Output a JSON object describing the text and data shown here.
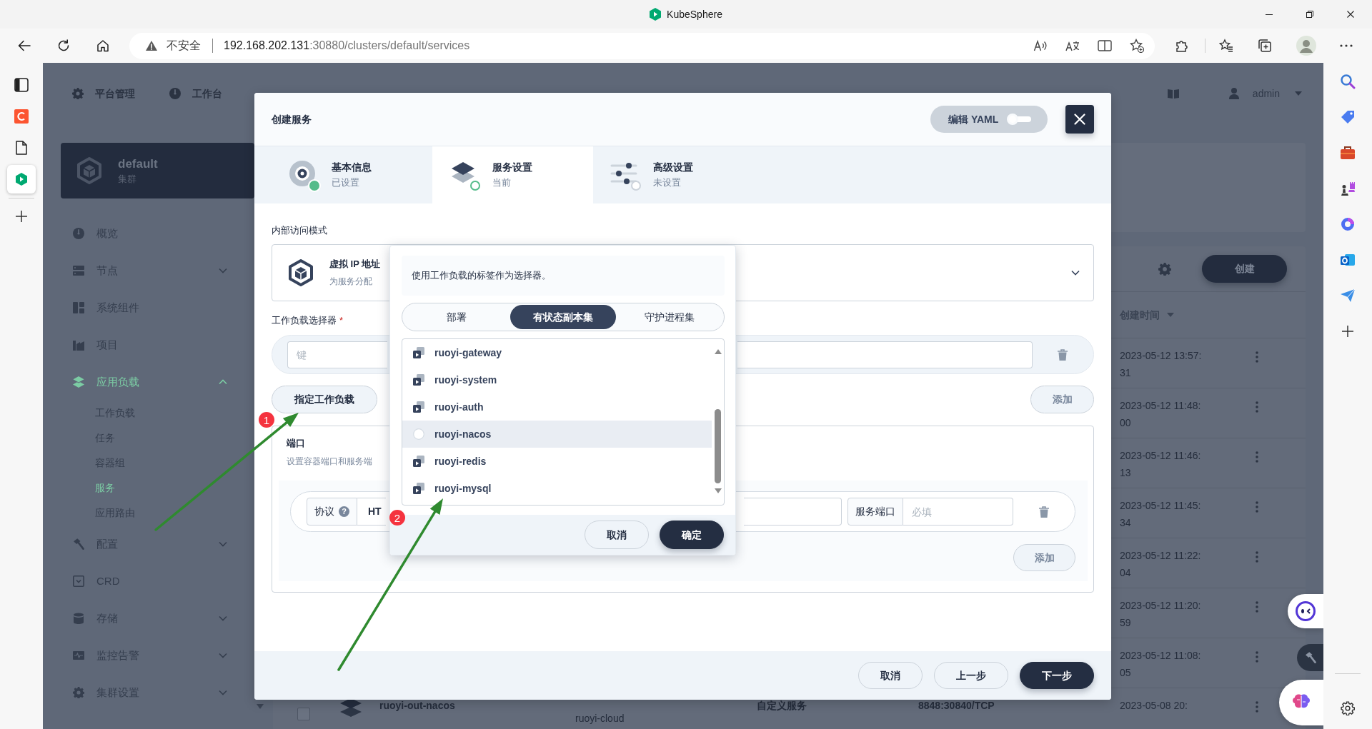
{
  "browser": {
    "title": "KubeSphere",
    "security_label": "不安全",
    "url_host": "192.168.202.131",
    "url_path": ":30880/clusters/default/services",
    "side_tabs": [
      {
        "selected": false
      },
      {
        "selected": false
      },
      {
        "selected": false
      },
      {
        "selected": true
      }
    ]
  },
  "console": {
    "top_nav": [
      "平台管理",
      "工作台"
    ],
    "user": "admin",
    "cluster": {
      "name": "default",
      "type": "集群"
    },
    "nav": [
      {
        "label": "概览",
        "kind": "link",
        "selected": false
      },
      {
        "label": "节点",
        "kind": "group",
        "expanded": false,
        "selected": false
      },
      {
        "label": "系统组件",
        "kind": "link",
        "selected": false
      },
      {
        "label": "项目",
        "kind": "link",
        "selected": false
      },
      {
        "label": "应用负载",
        "kind": "group",
        "expanded": true,
        "selected": true,
        "children": [
          {
            "label": "工作负载",
            "selected": false
          },
          {
            "label": "任务",
            "selected": false
          },
          {
            "label": "容器组",
            "selected": false
          },
          {
            "label": "服务",
            "selected": true
          },
          {
            "label": "应用路由",
            "selected": false
          }
        ]
      },
      {
        "label": "配置",
        "kind": "group",
        "expanded": false,
        "selected": false
      },
      {
        "label": "CRD",
        "kind": "link",
        "selected": false
      },
      {
        "label": "存储",
        "kind": "group",
        "expanded": false,
        "selected": false
      },
      {
        "label": "监控告警",
        "kind": "group",
        "expanded": false,
        "selected": false
      },
      {
        "label": "集群设置",
        "kind": "group",
        "expanded": false,
        "selected": false
      }
    ],
    "create_button": "创建",
    "table": {
      "columns": [
        {
          "label": "创建时间"
        }
      ],
      "rows": [
        {
          "created": "2023-05-12 13:57:31"
        },
        {
          "created": "2023-05-12 11:48:00"
        },
        {
          "created": "2023-05-12 11:46:13"
        },
        {
          "created": "2023-05-12 11:45:34"
        },
        {
          "created": "2023-05-12 11:22:04"
        },
        {
          "created": "2023-05-12 11:20:59"
        },
        {
          "created": "2023-05-12 11:08:05"
        },
        {
          "checked": false,
          "name": "ruoyi-out-nacos",
          "project": "ruoyi-cloud",
          "type": "自定义服务",
          "ports": "8848:30840/TCP",
          "created": "2023-05-08 20:"
        }
      ]
    }
  },
  "modal": {
    "title": "创建服务",
    "yaml_toggle": {
      "label": "编辑 YAML",
      "on": false
    },
    "steps": [
      {
        "title": "基本信息",
        "status": "已设置",
        "selected": false,
        "completed": true
      },
      {
        "title": "服务设置",
        "status": "当前",
        "selected": true,
        "completed": false
      },
      {
        "title": "高级设置",
        "status": "未设置",
        "selected": false,
        "completed": false
      }
    ],
    "access_mode": {
      "label": "内部访问模式",
      "title": "虚拟 IP 地址",
      "description": "为服务分配"
    },
    "selector": {
      "label": "工作负载选择器",
      "required_mark": "*",
      "key_field": {
        "placeholder": "键"
      },
      "specify_button": "指定工作负载",
      "add_button": "添加"
    },
    "ports": {
      "title": "端口",
      "description": "设置容器端口和服务端",
      "rows": [
        {
          "protocol_label": "协议",
          "help": "?",
          "protocol": "HT",
          "service_port_label": "服务端口",
          "service_port": {
            "placeholder": "必填"
          }
        }
      ],
      "add_button": "添加"
    },
    "footer_buttons": [
      {
        "label": "取消",
        "kind": "secondary"
      },
      {
        "label": "上一步",
        "kind": "secondary"
      },
      {
        "label": "下一步",
        "kind": "primary"
      }
    ],
    "workload_picker": {
      "hint": "使用工作负载的标签作为选择器。",
      "tabs": [
        {
          "label": "部署",
          "selected": false
        },
        {
          "label": "有状态副本集",
          "selected": true
        },
        {
          "label": "守护进程集",
          "selected": false
        }
      ],
      "workloads": [
        {
          "name": "ruoyi-gateway",
          "kind": "statefulset",
          "hovered": false
        },
        {
          "name": "ruoyi-system",
          "kind": "statefulset",
          "hovered": false
        },
        {
          "name": "ruoyi-auth",
          "kind": "statefulset",
          "hovered": false
        },
        {
          "name": "ruoyi-nacos",
          "kind": "empty",
          "hovered": true
        },
        {
          "name": "ruoyi-redis",
          "kind": "statefulset",
          "hovered": false
        },
        {
          "name": "ruoyi-mysql",
          "kind": "statefulset",
          "hovered": false
        }
      ],
      "buttons": [
        {
          "label": "取消",
          "kind": "secondary"
        },
        {
          "label": "确定",
          "kind": "primary"
        }
      ]
    }
  },
  "annotations": [
    {
      "number": "1"
    },
    {
      "number": "2"
    }
  ]
}
